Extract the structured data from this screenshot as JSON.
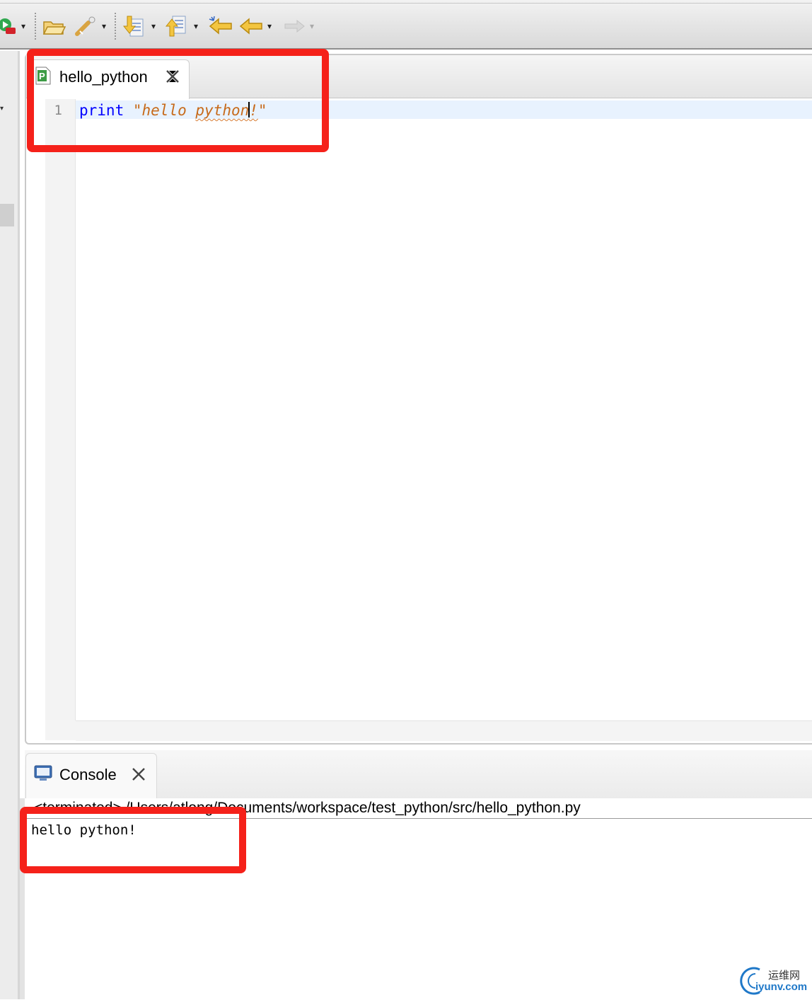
{
  "toolbar": {
    "icons": [
      "run-debug-icon",
      "open-folder-icon",
      "wand-icon",
      "next-annotation-icon",
      "prev-annotation-icon",
      "last-edit-location-icon",
      "back-icon",
      "forward-icon"
    ],
    "dropdown_glyph": "▾"
  },
  "editor": {
    "tab_title": "hello_python",
    "line_numbers": [
      "1"
    ],
    "code": {
      "keyword": "print",
      "string_open": "\"hello ",
      "string_misspelled_before_caret": "python",
      "string_after_caret": "!",
      "string_close": "\""
    }
  },
  "console": {
    "tab_title": "Console",
    "terminated_line": "<terminated> /Users/atlong/Documents/workspace/test_python/src/hello_python.py",
    "output": "hello python!"
  },
  "watermark": {
    "cn": "运维网",
    "en": "iyunv.com"
  },
  "colors": {
    "keyword": "#0000ff",
    "string": "#c76a1a",
    "annotation_box": "#f5211a",
    "current_line": "#e8f2fe"
  }
}
